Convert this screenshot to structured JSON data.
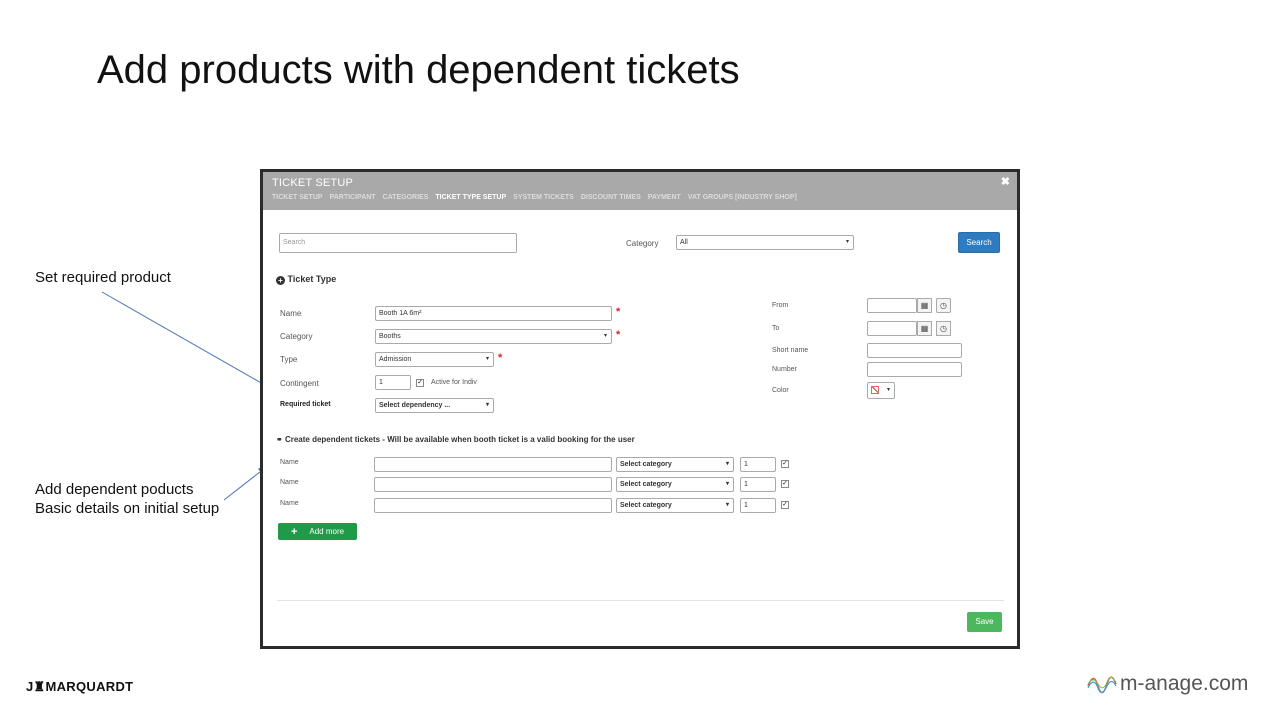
{
  "slide": {
    "title": "Add products with dependent tickets",
    "annotation_1": "Set required product",
    "annotation_2_line1": "Add dependent poducts",
    "annotation_2_line2": "Basic details on initial setup",
    "logo_left": "J♜MARQUARDT",
    "logo_right": "m-anage.com"
  },
  "dialog": {
    "title": "TICKET SETUP",
    "close": "✖",
    "tabs": [
      {
        "label": "TICKET SETUP"
      },
      {
        "label": "PARTICIPANT"
      },
      {
        "label": "CATEGORIES"
      },
      {
        "label": "TICKET TYPE SETUP",
        "active": true
      },
      {
        "label": "SYSTEM TICKETS"
      },
      {
        "label": "DISCOUNT TIMES"
      },
      {
        "label": "PAYMENT"
      },
      {
        "label": "VAT GROUPS [INDUSTRY SHOP]"
      }
    ],
    "search": {
      "placeholder": "Search",
      "category_label": "Category",
      "category_value": "All",
      "button": "Search"
    },
    "ticket_type": {
      "heading": "Ticket Type",
      "name_label": "Name",
      "name_value": "Booth 1A 6m²",
      "category_label": "Category",
      "category_value": "Booths",
      "type_label": "Type",
      "type_value": "Admission",
      "contingent_label": "Contingent",
      "contingent_value": "1",
      "active_label": "Active for Indiv",
      "required_label": "Required ticket",
      "required_value": "Select dependency ...",
      "from_label": "From",
      "to_label": "To",
      "short_name_label": "Short name",
      "number_label": "Number",
      "color_label": "Color",
      "required_marker": "*",
      "caret": "▾"
    },
    "dependent": {
      "heading": "Create dependent tickets - Will be available when booth ticket is a valid booking for the user",
      "rows": [
        {
          "label": "Name",
          "category": "Select category",
          "qty": "1"
        },
        {
          "label": "Name",
          "category": "Select category",
          "qty": "1"
        },
        {
          "label": "Name",
          "category": "Select category",
          "qty": "1"
        }
      ],
      "add_more": "Add more",
      "add_icon": "+"
    },
    "save": "Save"
  },
  "colors": {
    "header_bg": "#a9a9a9",
    "primary": "#2f7bbf",
    "green": "#1f9a48",
    "save": "#4cb75d",
    "required": "#e02020",
    "arrow": "#4a72b8"
  }
}
